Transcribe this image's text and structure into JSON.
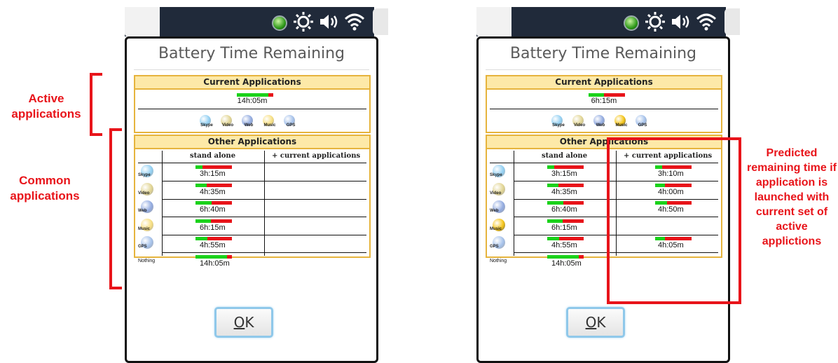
{
  "annotations": {
    "active": "Active applications",
    "common": "Common applications",
    "predicted": "Predicted remaining time if application is launched with current set of active applictions"
  },
  "dialog": {
    "title": "Battery Time Remaining",
    "current_header": "Current Applications",
    "other_header": "Other Applications",
    "col_standalone": "stand alone",
    "col_current": "+ current applications",
    "ok_label": "OK",
    "ok_mnemonic": "O",
    "ok_rest": "K"
  },
  "app_names": [
    "Skype",
    "Video",
    "Web",
    "Music",
    "GPS",
    "Nothing"
  ],
  "colors": {
    "accent_red": "#e8141a",
    "bar_green": "#1bd21b",
    "bar_red": "#e8141a",
    "section_border": "#e6b43d",
    "section_header": "#fde9a8"
  },
  "screens": [
    {
      "current_time": "14h:05m",
      "current_fraction": 0.86,
      "active_apps": [
        "Skype",
        "Video",
        "Web",
        "Music",
        "GPS"
      ],
      "highlighted_app": "",
      "rows": [
        {
          "app": "Skype",
          "standalone": "3h:15m",
          "standalone_fraction": 0.2,
          "combined": "",
          "combined_fraction": null
        },
        {
          "app": "Video",
          "standalone": "4h:35m",
          "standalone_fraction": 0.3,
          "combined": "",
          "combined_fraction": null
        },
        {
          "app": "Web",
          "standalone": "6h:40m",
          "standalone_fraction": 0.45,
          "combined": "",
          "combined_fraction": null
        },
        {
          "app": "Music",
          "standalone": "6h:15m",
          "standalone_fraction": 0.42,
          "combined": "",
          "combined_fraction": null
        },
        {
          "app": "GPS",
          "standalone": "4h:55m",
          "standalone_fraction": 0.33,
          "combined": "",
          "combined_fraction": null
        },
        {
          "app": "Nothing",
          "standalone": "14h:05m",
          "standalone_fraction": 0.86,
          "combined": "",
          "combined_fraction": null
        }
      ]
    },
    {
      "current_time": "6h:15m",
      "current_fraction": 0.42,
      "active_apps": [
        "Skype",
        "Video",
        "Web",
        "Music",
        "GPS"
      ],
      "highlighted_app": "Music",
      "rows": [
        {
          "app": "Skype",
          "standalone": "3h:15m",
          "standalone_fraction": 0.2,
          "combined": "3h:10m",
          "combined_fraction": 0.2
        },
        {
          "app": "Video",
          "standalone": "4h:35m",
          "standalone_fraction": 0.3,
          "combined": "4h:00m",
          "combined_fraction": 0.26
        },
        {
          "app": "Web",
          "standalone": "6h:40m",
          "standalone_fraction": 0.45,
          "combined": "4h:50m",
          "combined_fraction": 0.33
        },
        {
          "app": "Music",
          "standalone": "6h:15m",
          "standalone_fraction": 0.42,
          "combined": "",
          "combined_fraction": null
        },
        {
          "app": "GPS",
          "standalone": "4h:55m",
          "standalone_fraction": 0.33,
          "combined": "4h:05m",
          "combined_fraction": 0.27
        },
        {
          "app": "Nothing",
          "standalone": "14h:05m",
          "standalone_fraction": 0.86,
          "combined": "",
          "combined_fraction": null
        }
      ]
    }
  ]
}
